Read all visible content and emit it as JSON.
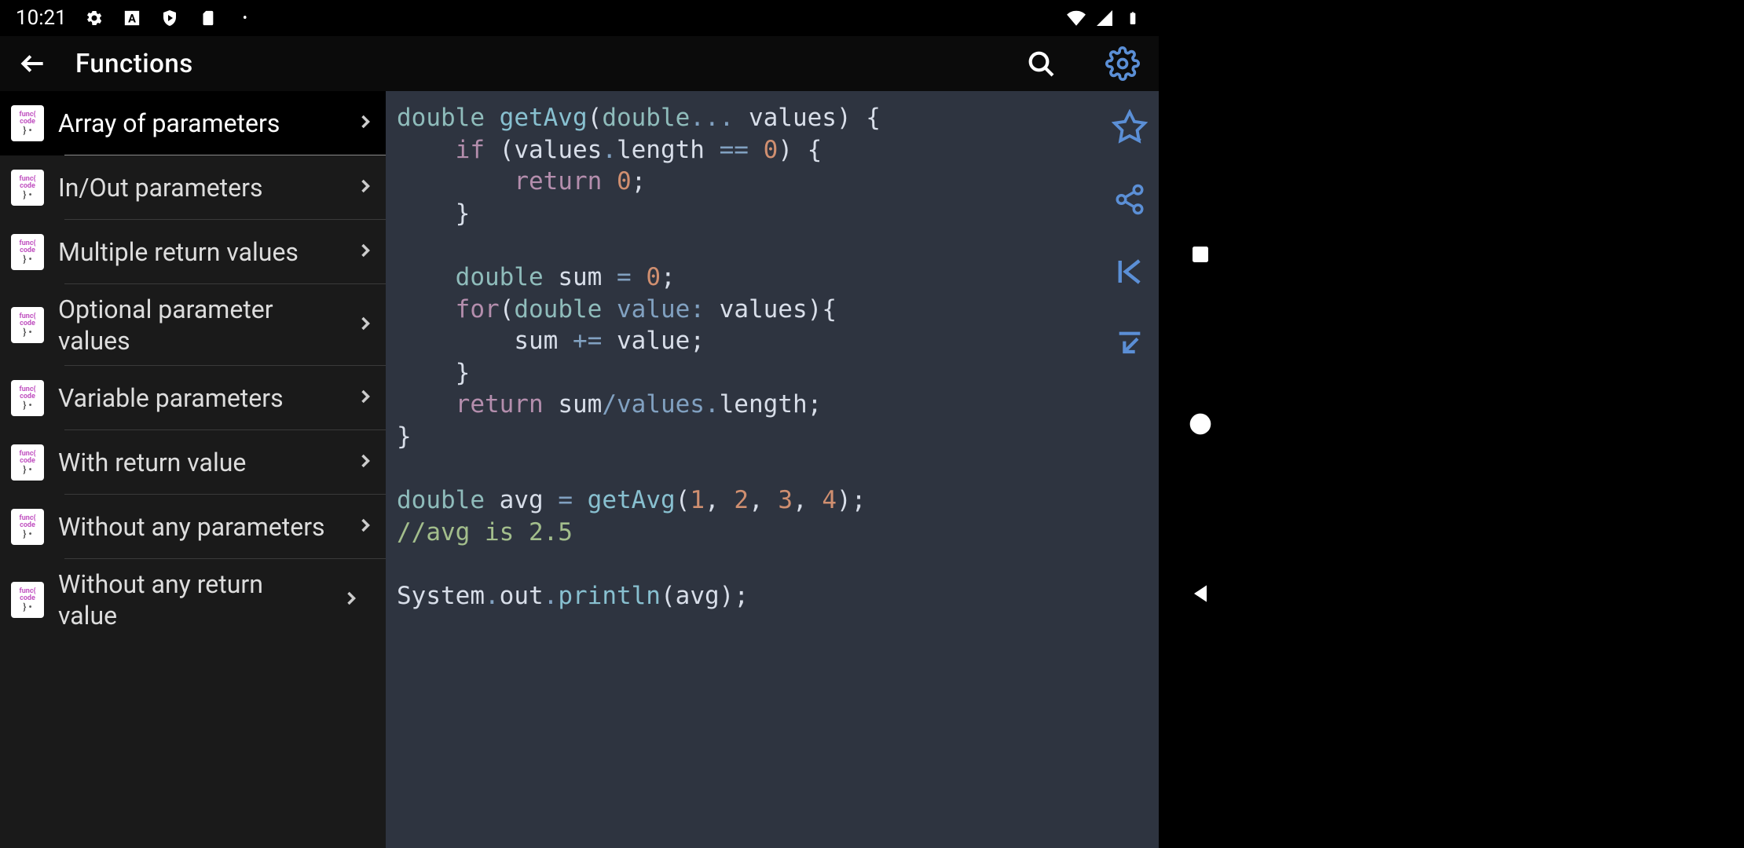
{
  "status": {
    "time": "10:21"
  },
  "app": {
    "title": "Functions"
  },
  "sidebar": {
    "items": [
      {
        "label": "Array of parameters",
        "selected": true
      },
      {
        "label": "In/Out parameters",
        "selected": false
      },
      {
        "label": "Multiple return values",
        "selected": false
      },
      {
        "label": "Optional parameter values",
        "selected": false
      },
      {
        "label": "Variable parameters",
        "selected": false
      },
      {
        "label": "With return value",
        "selected": false
      },
      {
        "label": "Without any parameters",
        "selected": false
      },
      {
        "label": "Without any return value",
        "selected": false
      }
    ]
  },
  "code": {
    "tokens": [
      [
        [
          "type",
          "double"
        ],
        [
          "sp",
          " "
        ],
        [
          "fn",
          "getAvg"
        ],
        [
          "punc",
          "("
        ],
        [
          "type",
          "double"
        ],
        [
          "op",
          "..."
        ],
        [
          "sp",
          " "
        ],
        [
          "ident",
          "values"
        ],
        [
          "punc",
          ")"
        ],
        [
          "sp",
          " "
        ],
        [
          "punc",
          "{"
        ]
      ],
      [
        [
          "sp",
          "    "
        ],
        [
          "kw",
          "if"
        ],
        [
          "sp",
          " "
        ],
        [
          "punc",
          "("
        ],
        [
          "ident",
          "values"
        ],
        [
          "op",
          "."
        ],
        [
          "ident",
          "length"
        ],
        [
          "sp",
          " "
        ],
        [
          "op",
          "=="
        ],
        [
          "sp",
          " "
        ],
        [
          "num",
          "0"
        ],
        [
          "punc",
          ")"
        ],
        [
          "sp",
          " "
        ],
        [
          "punc",
          "{"
        ]
      ],
      [
        [
          "sp",
          "        "
        ],
        [
          "kw",
          "return"
        ],
        [
          "sp",
          " "
        ],
        [
          "num",
          "0"
        ],
        [
          "punc",
          ";"
        ]
      ],
      [
        [
          "sp",
          "    "
        ],
        [
          "punc",
          "}"
        ]
      ],
      [],
      [
        [
          "sp",
          "    "
        ],
        [
          "type",
          "double"
        ],
        [
          "sp",
          " "
        ],
        [
          "ident",
          "sum"
        ],
        [
          "sp",
          " "
        ],
        [
          "op",
          "="
        ],
        [
          "sp",
          " "
        ],
        [
          "num",
          "0"
        ],
        [
          "punc",
          ";"
        ]
      ],
      [
        [
          "sp",
          "    "
        ],
        [
          "kw",
          "for"
        ],
        [
          "punc",
          "("
        ],
        [
          "type",
          "double"
        ],
        [
          "sp",
          " "
        ],
        [
          "var",
          "value"
        ],
        [
          "op",
          ":"
        ],
        [
          "sp",
          " "
        ],
        [
          "ident",
          "values"
        ],
        [
          "punc",
          ")"
        ],
        [
          "punc",
          "{"
        ]
      ],
      [
        [
          "sp",
          "        "
        ],
        [
          "ident",
          "sum"
        ],
        [
          "sp",
          " "
        ],
        [
          "op",
          "+="
        ],
        [
          "sp",
          " "
        ],
        [
          "ident",
          "value"
        ],
        [
          "punc",
          ";"
        ]
      ],
      [
        [
          "sp",
          "    "
        ],
        [
          "punc",
          "}"
        ]
      ],
      [
        [
          "sp",
          "    "
        ],
        [
          "kw",
          "return"
        ],
        [
          "sp",
          " "
        ],
        [
          "ident",
          "sum"
        ],
        [
          "op",
          "/"
        ],
        [
          "var",
          "values"
        ],
        [
          "op",
          "."
        ],
        [
          "ident",
          "length"
        ],
        [
          "punc",
          ";"
        ]
      ],
      [
        [
          "punc",
          "}"
        ]
      ],
      [],
      [
        [
          "type",
          "double"
        ],
        [
          "sp",
          " "
        ],
        [
          "ident",
          "avg"
        ],
        [
          "sp",
          " "
        ],
        [
          "op",
          "="
        ],
        [
          "sp",
          " "
        ],
        [
          "call",
          "getAvg"
        ],
        [
          "punc",
          "("
        ],
        [
          "num",
          "1"
        ],
        [
          "punc",
          ","
        ],
        [
          "sp",
          " "
        ],
        [
          "num",
          "2"
        ],
        [
          "punc",
          ","
        ],
        [
          "sp",
          " "
        ],
        [
          "num",
          "3"
        ],
        [
          "punc",
          ","
        ],
        [
          "sp",
          " "
        ],
        [
          "num",
          "4"
        ],
        [
          "punc",
          ")"
        ],
        [
          "punc",
          ";"
        ]
      ],
      [
        [
          "comm",
          "//avg is 2.5"
        ]
      ],
      [],
      [
        [
          "ident",
          "System"
        ],
        [
          "op",
          "."
        ],
        [
          "ident",
          "out"
        ],
        [
          "op",
          "."
        ],
        [
          "call",
          "println"
        ],
        [
          "punc",
          "("
        ],
        [
          "ident",
          "avg"
        ],
        [
          "punc",
          ")"
        ],
        [
          "punc",
          ";"
        ]
      ]
    ]
  }
}
